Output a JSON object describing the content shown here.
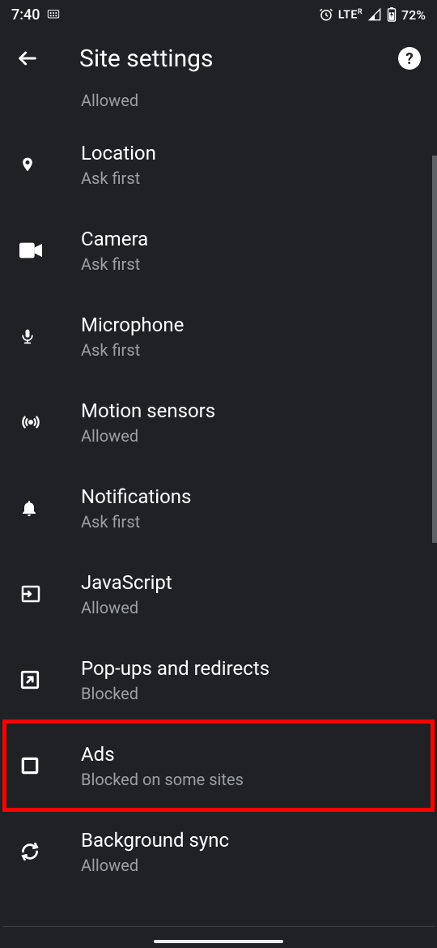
{
  "status": {
    "time": "7:40",
    "lte": "LTE",
    "lte_sup": "R",
    "battery": "72%"
  },
  "header": {
    "title": "Site settings"
  },
  "items": {
    "partial": {
      "sub": "Allowed"
    },
    "location": {
      "title": "Location",
      "sub": "Ask first"
    },
    "camera": {
      "title": "Camera",
      "sub": "Ask first"
    },
    "microphone": {
      "title": "Microphone",
      "sub": "Ask first"
    },
    "motion": {
      "title": "Motion sensors",
      "sub": "Allowed"
    },
    "notifications": {
      "title": "Notifications",
      "sub": "Ask first"
    },
    "javascript": {
      "title": "JavaScript",
      "sub": "Allowed"
    },
    "popups": {
      "title": "Pop-ups and redirects",
      "sub": "Blocked"
    },
    "ads": {
      "title": "Ads",
      "sub": "Blocked on some sites"
    },
    "bgsync": {
      "title": "Background sync",
      "sub": "Allowed"
    }
  }
}
